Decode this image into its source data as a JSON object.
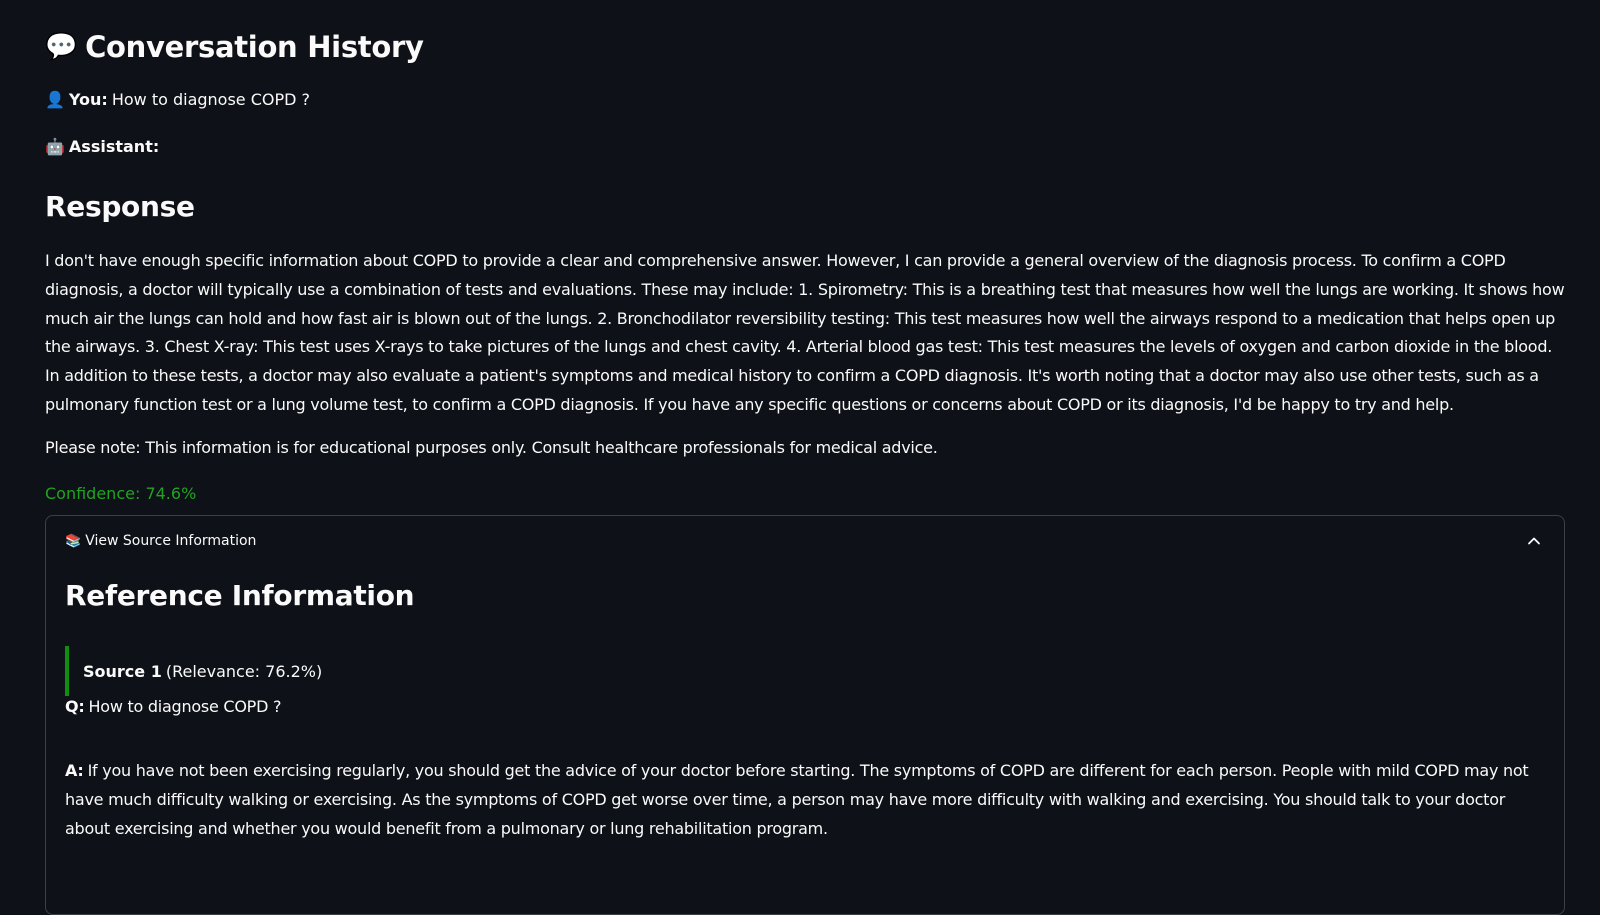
{
  "history": {
    "title": "Conversation History",
    "title_icon": "speech-balloon-icon",
    "user_label": "You:",
    "user_icon": "user-silhouette-icon",
    "user_message": "How to diagnose COPD ?",
    "assistant_label": "Assistant:",
    "assistant_icon": "robot-icon"
  },
  "response": {
    "heading": "Response",
    "body": "I don't have enough specific information about COPD to provide a clear and comprehensive answer. However, I can provide a general overview of the diagnosis process. To confirm a COPD diagnosis, a doctor will typically use a combination of tests and evaluations. These may include: 1. Spirometry: This is a breathing test that measures how well the lungs are working. It shows how much air the lungs can hold and how fast air is blown out of the lungs. 2. Bronchodilator reversibility testing: This test measures how well the airways respond to a medication that helps open up the airways. 3. Chest X-ray: This test uses X-rays to take pictures of the lungs and chest cavity. 4. Arterial blood gas test: This test measures the levels of oxygen and carbon dioxide in the blood. In addition to these tests, a doctor may also evaluate a patient's symptoms and medical history to confirm a COPD diagnosis. It's worth noting that a doctor may also use other tests, such as a pulmonary function test or a lung volume test, to confirm a COPD diagnosis. If you have any specific questions or concerns about COPD or its diagnosis, I'd be happy to try and help.",
    "note": "Please note: This information is for educational purposes only. Consult healthcare professionals for medical advice.",
    "confidence": "Confidence: 74.6%",
    "confidence_color": "#21a321"
  },
  "expander": {
    "label": "View Source Information",
    "icon": "books-icon",
    "chevron_icon": "chevron-up-icon",
    "expanded": true,
    "ref_heading": "Reference Information",
    "source_label": "Source 1",
    "source_relevance": "(Relevance: 76.2%)",
    "q_label": "Q:",
    "question": "How to diagnose COPD ?",
    "a_label": "A:",
    "answer": "If you have not been exercising regularly, you should get the advice of your doctor before starting. The symptoms of COPD are different for each person. People with mild COPD may not have much difficulty walking or exercising. As the symptoms of COPD get worse over time, a person may have more difficulty with walking and exercising. You should talk to your doctor about exercising and whether you would benefit from a pulmonary or lung rehabilitation program.",
    "accent_color": "#0e8f0e"
  }
}
